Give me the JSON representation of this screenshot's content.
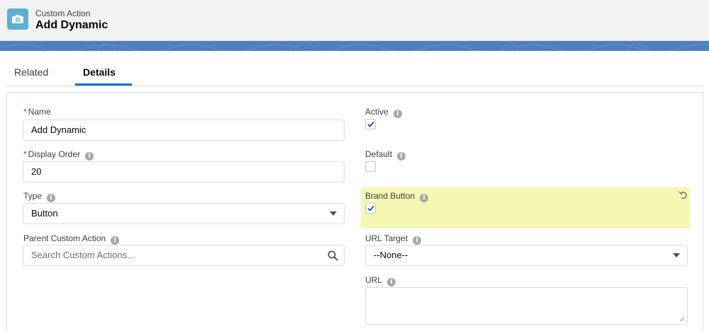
{
  "header": {
    "kicker": "Custom Action",
    "title": "Add Dynamic",
    "icon": "camera-icon",
    "icon_color": "#5ab0d2"
  },
  "banner": {
    "color": "#4f7fbd"
  },
  "tabs": [
    {
      "label": "Related",
      "active": false
    },
    {
      "label": "Details",
      "active": true
    }
  ],
  "form": {
    "required_marker": "*",
    "info_glyph": "i",
    "name": {
      "label": "Name",
      "value": "Add Dynamic",
      "required": true
    },
    "display_order": {
      "label": "Display Order",
      "value": "20",
      "required": true
    },
    "type": {
      "label": "Type",
      "value": "Button"
    },
    "parent_custom_action": {
      "label": "Parent Custom Action",
      "placeholder": "Search Custom Actions..."
    },
    "active": {
      "label": "Active",
      "checked": true
    },
    "default": {
      "label": "Default",
      "checked": false
    },
    "brand_button": {
      "label": "Brand Button",
      "checked": true,
      "highlight_color": "#f5f7b5"
    },
    "url_target": {
      "label": "URL Target",
      "value": "--None--"
    },
    "url": {
      "label": "URL",
      "value": ""
    }
  }
}
